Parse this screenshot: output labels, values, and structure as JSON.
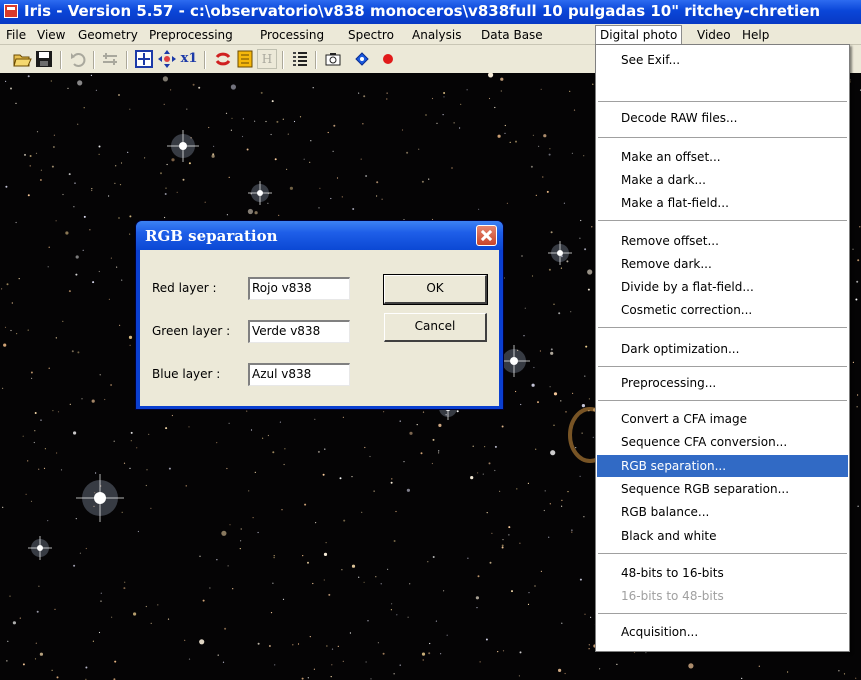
{
  "window": {
    "title": "Iris - Version 5.57 - c:\\observatorio\\v838 monoceros\\v838full 10 pulgadas 10\" ritchey-chretien",
    "icon": "iris-app-icon"
  },
  "menubar": {
    "items": [
      "File",
      "View",
      "Geometry",
      "Preprocessing",
      "Processing",
      "Spectro",
      "Analysis",
      "Data Base",
      "Digital photo",
      "Video",
      "Help"
    ],
    "open_item": "Digital photo"
  },
  "toolbar": {
    "icons": [
      "open-folder-icon",
      "save-disk-icon",
      "undo-icon",
      "compare-icon",
      "zoom-region-icon",
      "move-icon",
      "zoom-x1-icon",
      "refresh-icon",
      "notes-icon",
      "header-icon",
      "list-icon",
      "camera-icon",
      "blue-diamond-icon",
      "record-icon"
    ],
    "x1_label": "x1",
    "h_label": "H"
  },
  "dropdown": {
    "items": [
      {
        "label": "See Exif...",
        "state": "normal"
      },
      {
        "label": "Decode RAW files...",
        "state": "normal"
      },
      {
        "label": "Make an offset...",
        "state": "normal"
      },
      {
        "label": "Make a dark...",
        "state": "normal"
      },
      {
        "label": "Make a flat-field...",
        "state": "normal"
      },
      {
        "label": "Remove offset...",
        "state": "normal"
      },
      {
        "label": "Remove dark...",
        "state": "normal"
      },
      {
        "label": "Divide by a flat-field...",
        "state": "normal"
      },
      {
        "label": "Cosmetic correction...",
        "state": "normal"
      },
      {
        "label": "Dark optimization...",
        "state": "normal"
      },
      {
        "label": "Preprocessing...",
        "state": "normal"
      },
      {
        "label": "Convert a CFA image",
        "state": "normal"
      },
      {
        "label": "Sequence CFA conversion...",
        "state": "normal"
      },
      {
        "label": "RGB separation...",
        "state": "highlighted"
      },
      {
        "label": "Sequence RGB separation...",
        "state": "normal"
      },
      {
        "label": "RGB balance...",
        "state": "normal"
      },
      {
        "label": "Black and white",
        "state": "normal"
      },
      {
        "label": "48-bits to 16-bits",
        "state": "normal"
      },
      {
        "label": "16-bits to 48-bits",
        "state": "disabled"
      },
      {
        "label": "Acquisition...",
        "state": "normal"
      }
    ]
  },
  "dialog": {
    "title": "RGB separation",
    "red_label": "Red layer :",
    "red_value": "Rojo v838",
    "green_label": "Green layer :",
    "green_value": "Verde v838",
    "blue_label": "Blue layer :",
    "blue_value": "Azul v838",
    "ok_label": "OK",
    "cancel_label": "Cancel"
  },
  "colors": {
    "title_bar": "#0a46d8",
    "menu_highlight": "#316ac5",
    "sky": "#050405",
    "close_button": "#c9452b"
  }
}
